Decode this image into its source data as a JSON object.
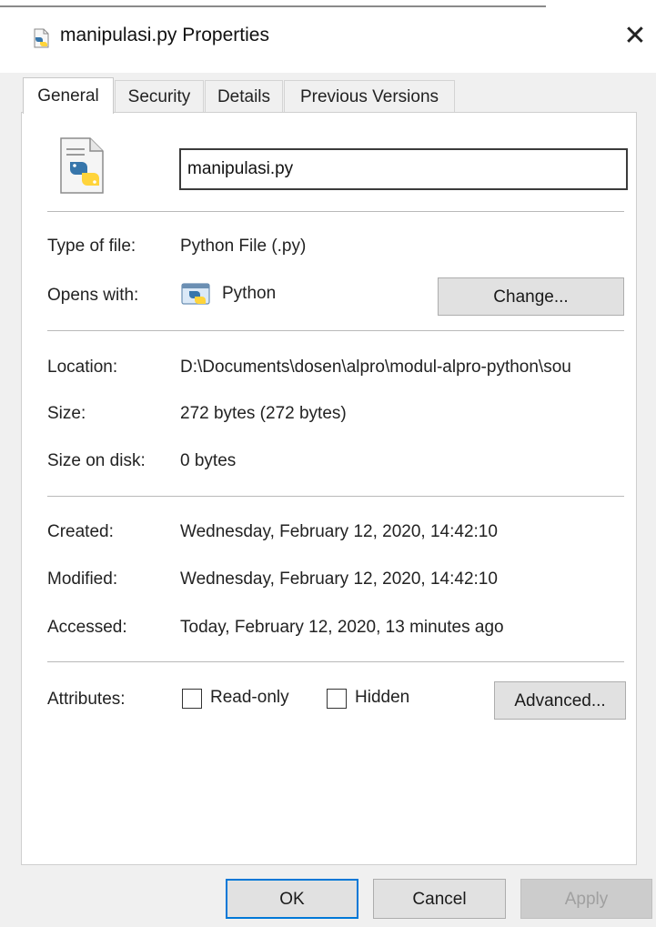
{
  "window": {
    "title": "manipulasi.py Properties",
    "close_glyph": "✕"
  },
  "tabs": [
    {
      "label": "General",
      "active": true
    },
    {
      "label": "Security",
      "active": false
    },
    {
      "label": "Details",
      "active": false
    },
    {
      "label": "Previous Versions",
      "active": false
    }
  ],
  "general": {
    "file_name": "manipulasi.py",
    "file_icon": "python-file-icon",
    "type_label": "Type of file:",
    "type_value": "Python File (.py)",
    "opens_label": "Opens with:",
    "opens_icon": "python-launcher-icon",
    "opens_value": "Python",
    "change_button": "Change...",
    "location_label": "Location:",
    "location_value": "D:\\Documents\\dosen\\alpro\\modul-alpro-python\\sou",
    "size_label": "Size:",
    "size_value": "272 bytes (272 bytes)",
    "size_on_disk_label": "Size on disk:",
    "size_on_disk_value": "0 bytes",
    "created_label": "Created:",
    "created_value": "Wednesday, February 12, 2020, 14:42:10",
    "modified_label": "Modified:",
    "modified_value": "Wednesday, February 12, 2020, 14:42:10",
    "accessed_label": "Accessed:",
    "accessed_value": "Today, February 12, 2020, 13 minutes ago",
    "attributes_label": "Attributes:",
    "readonly_label": "Read-only",
    "readonly_checked": false,
    "hidden_label": "Hidden",
    "hidden_checked": false,
    "advanced_button": "Advanced..."
  },
  "footer": {
    "ok": "OK",
    "cancel": "Cancel",
    "apply": "Apply",
    "apply_enabled": false
  },
  "colors": {
    "accent_blue": "#0078d7",
    "python_blue": "#3776ab",
    "python_yellow": "#ffd43b",
    "disabled_text": "#a0a0a0"
  }
}
